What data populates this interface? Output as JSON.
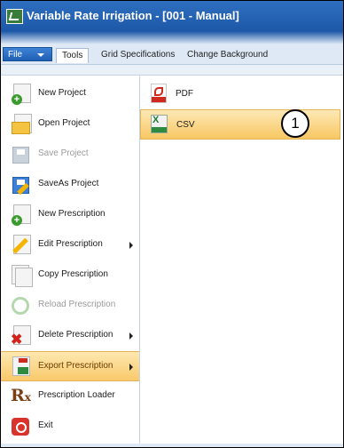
{
  "window": {
    "title": "Variable Rate Irrigation - [001 - Manual]"
  },
  "ribbon": {
    "file_tab": "File",
    "tabs": [
      "Tools",
      "Grid Specifications",
      "Change Background"
    ]
  },
  "menu": {
    "items": [
      {
        "label": "New Project",
        "icon": "new-project-icon",
        "enabled": true
      },
      {
        "label": "Open Project",
        "icon": "folder-icon",
        "enabled": true
      },
      {
        "label": "Save Project",
        "icon": "save-icon",
        "enabled": false
      },
      {
        "label": "SaveAs Project",
        "icon": "save-as-icon",
        "enabled": true
      },
      {
        "label": "New Prescription",
        "icon": "new-prescription-icon",
        "enabled": true
      },
      {
        "label": "Edit Prescription",
        "icon": "edit-icon",
        "enabled": true,
        "submenu": true
      },
      {
        "label": "Copy Prescription",
        "icon": "copy-icon",
        "enabled": true
      },
      {
        "label": "Reload Prescription",
        "icon": "reload-icon",
        "enabled": false
      },
      {
        "label": "Delete Prescription",
        "icon": "delete-icon",
        "enabled": true,
        "submenu": true
      },
      {
        "label": "Export Prescription",
        "icon": "export-icon",
        "enabled": true,
        "submenu": true,
        "selected": true
      },
      {
        "label": "Prescription Loader",
        "icon": "rx-icon",
        "enabled": true
      },
      {
        "label": "Exit",
        "icon": "power-icon",
        "enabled": true
      }
    ]
  },
  "submenu": {
    "items": [
      {
        "label": "PDF",
        "icon": "pdf-icon"
      },
      {
        "label": "CSV",
        "icon": "csv-icon",
        "highlighted": true
      }
    ]
  },
  "callout": {
    "label": "1"
  }
}
